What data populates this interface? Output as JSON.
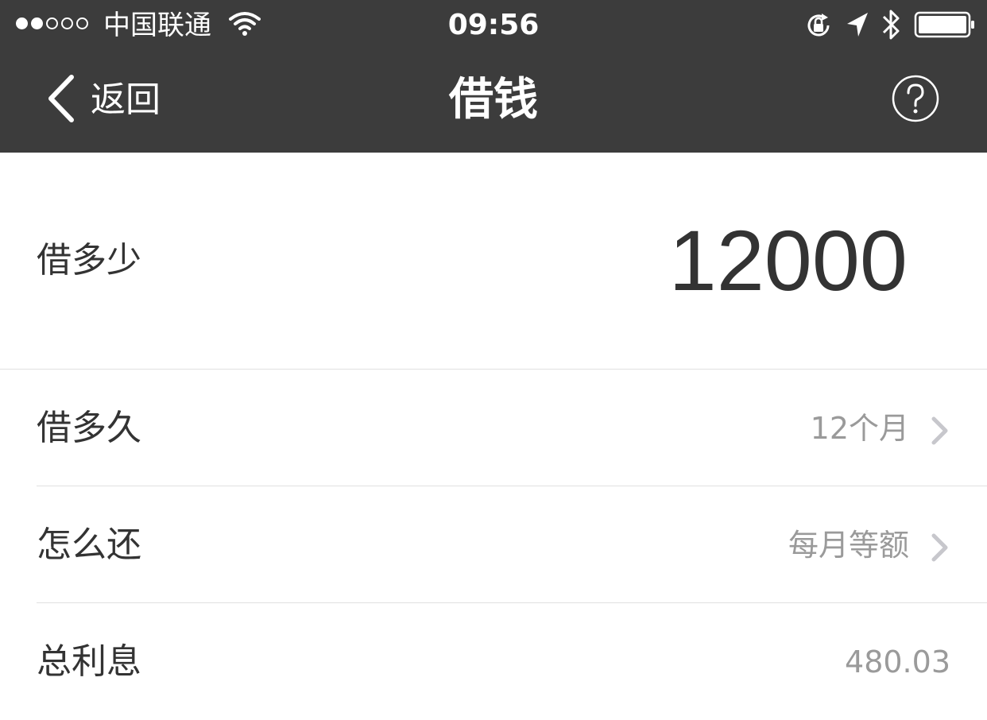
{
  "status_bar": {
    "carrier": "中国联通",
    "time": "09:56",
    "signal_filled": 2,
    "signal_total": 5,
    "icons": [
      "wifi-icon",
      "rotation-lock-icon",
      "location-arrow-icon",
      "bluetooth-icon",
      "battery-icon"
    ],
    "battery_level": 1.0
  },
  "nav": {
    "back_label": "返回",
    "title": "借钱",
    "help_icon": "question-mark-icon"
  },
  "form": {
    "amount": {
      "label": "借多少",
      "value": "12000"
    },
    "term": {
      "label": "借多久",
      "value": "12个月"
    },
    "repayment": {
      "label": "怎么还",
      "value": "每月等额"
    },
    "interest": {
      "label": "总利息",
      "value": "480.03"
    }
  },
  "colors": {
    "header_bg": "#3c3c3c",
    "text_primary": "#333333",
    "text_secondary": "#9a9a9a",
    "divider": "#e0e0e0",
    "chevron": "#c7c7cc"
  }
}
